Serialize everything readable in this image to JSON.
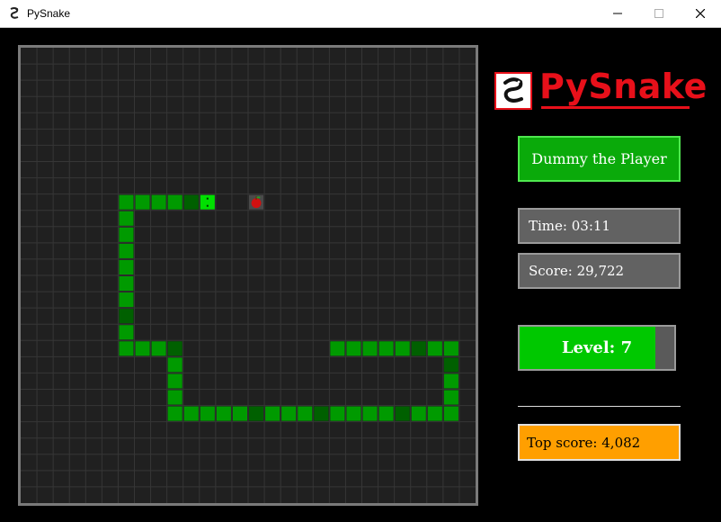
{
  "window": {
    "title": "PySnake",
    "minimize": "—",
    "maximize": "☐",
    "close": "✕"
  },
  "logo": {
    "text": "PySnake"
  },
  "player": {
    "name": "Dummy the Player"
  },
  "stats": {
    "time_label": "Time:",
    "time": "03:11",
    "score_label": "Score:",
    "score": "29,722",
    "level_label": "Level:",
    "level": "7",
    "level_progress": 0.88,
    "top_label": "Top score:",
    "top_score": "4,082"
  },
  "colors": {
    "board_bg": "#202020",
    "grid": "#363636",
    "border": "#7a7a7a",
    "snake_light": "#009a00",
    "snake_dark": "#006000",
    "snake_head": "#00e000",
    "food": "#d01010",
    "accent_red": "#e8101a",
    "player_green": "#0aaa0a",
    "panel_gray": "#626262",
    "level_green": "#00c800",
    "top_orange": "#ff9f00"
  },
  "game": {
    "cols": 28,
    "rows": 28,
    "food": {
      "col": 14,
      "row": 9,
      "icon": "apple-icon"
    },
    "head": {
      "col": 11,
      "row": 9
    },
    "snake": [
      [
        10,
        9
      ],
      [
        9,
        9
      ],
      [
        8,
        9
      ],
      [
        7,
        9
      ],
      [
        6,
        9
      ],
      [
        6,
        10
      ],
      [
        6,
        11
      ],
      [
        6,
        12
      ],
      [
        6,
        13
      ],
      [
        6,
        14
      ],
      [
        6,
        15
      ],
      [
        6,
        16
      ],
      [
        6,
        17
      ],
      [
        6,
        18
      ],
      [
        7,
        18
      ],
      [
        8,
        18
      ],
      [
        9,
        18
      ],
      [
        9,
        19
      ],
      [
        9,
        20
      ],
      [
        9,
        21
      ],
      [
        9,
        22
      ],
      [
        10,
        22
      ],
      [
        11,
        22
      ],
      [
        12,
        22
      ],
      [
        13,
        22
      ],
      [
        14,
        22
      ],
      [
        15,
        22
      ],
      [
        16,
        22
      ],
      [
        17,
        22
      ],
      [
        18,
        22
      ],
      [
        19,
        22
      ],
      [
        20,
        22
      ],
      [
        21,
        22
      ],
      [
        22,
        22
      ],
      [
        23,
        22
      ],
      [
        24,
        22
      ],
      [
        25,
        22
      ],
      [
        26,
        22
      ],
      [
        26,
        21
      ],
      [
        26,
        20
      ],
      [
        26,
        19
      ],
      [
        26,
        18
      ],
      [
        25,
        18
      ],
      [
        24,
        18
      ],
      [
        23,
        18
      ],
      [
        22,
        18
      ],
      [
        21,
        18
      ],
      [
        20,
        18
      ],
      [
        19,
        18
      ]
    ],
    "dark_segments": [
      0,
      11,
      16,
      25,
      29,
      34,
      40,
      43
    ]
  }
}
